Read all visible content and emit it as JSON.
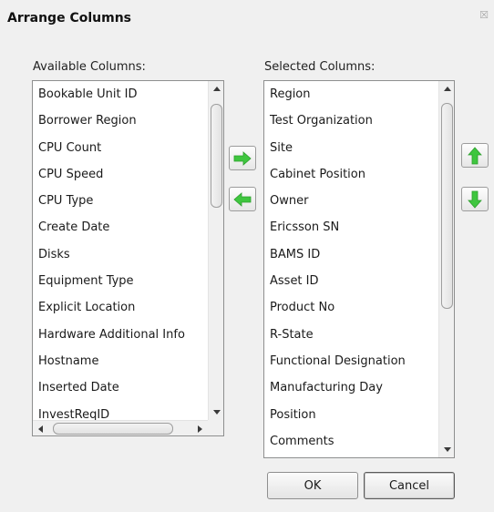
{
  "dialog": {
    "title": "Arrange Columns",
    "close_glyph": "☒"
  },
  "available": {
    "label": "Available Columns:",
    "items": [
      "Bookable Unit ID",
      "Borrower Region",
      "CPU Count",
      "CPU Speed",
      "CPU Type",
      "Create Date",
      "Disks",
      "Equipment Type",
      "Explicit Location",
      "Hardware Additional Info",
      "Hostname",
      "Inserted Date",
      "InvestReqID"
    ]
  },
  "selected": {
    "label": "Selected Columns:",
    "items": [
      "Region",
      "Test Organization",
      "Site",
      "Cabinet Position",
      "Owner",
      "Ericsson SN",
      "BAMS ID",
      "Asset ID",
      "Product No",
      "R-State",
      "Functional Designation",
      "Manufacturing Day",
      "Position",
      "Comments"
    ]
  },
  "buttons": {
    "ok": "OK",
    "cancel": "Cancel"
  },
  "icons": {
    "add": "arrow-right-icon",
    "remove": "arrow-left-icon",
    "move_up": "arrow-up-icon",
    "move_down": "arrow-down-icon",
    "arrow_color": "#3fc63f"
  }
}
